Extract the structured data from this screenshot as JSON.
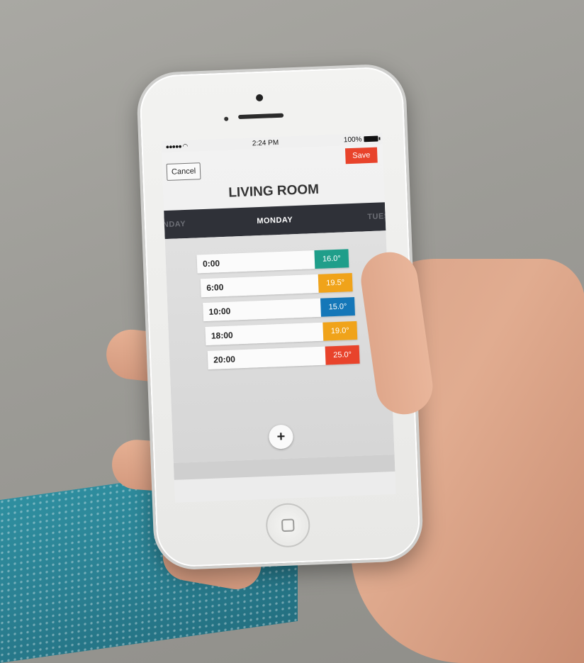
{
  "status_bar": {
    "signal": "●●●●● ",
    "time": "2:24 PM",
    "battery": "100%"
  },
  "nav": {
    "cancel_label": "Cancel",
    "save_label": "Save"
  },
  "room_title": "LIVING ROOM",
  "days": {
    "previous": "NDAY",
    "current": "MONDAY",
    "next": "TUES"
  },
  "schedule": [
    {
      "time": "0:00",
      "temp": "16.0°",
      "color": "#1f9e8a"
    },
    {
      "time": "6:00",
      "temp": "19.5°",
      "color": "#f0a31a"
    },
    {
      "time": "10:00",
      "temp": "15.0°",
      "color": "#1577b8"
    },
    {
      "time": "18:00",
      "temp": "19.0°",
      "color": "#f0a31a"
    },
    {
      "time": "20:00",
      "temp": "25.0°",
      "color": "#e8432b"
    }
  ],
  "add_label": "+",
  "colors": {
    "accent": "#e8432b",
    "day_band": "#2f3138"
  }
}
